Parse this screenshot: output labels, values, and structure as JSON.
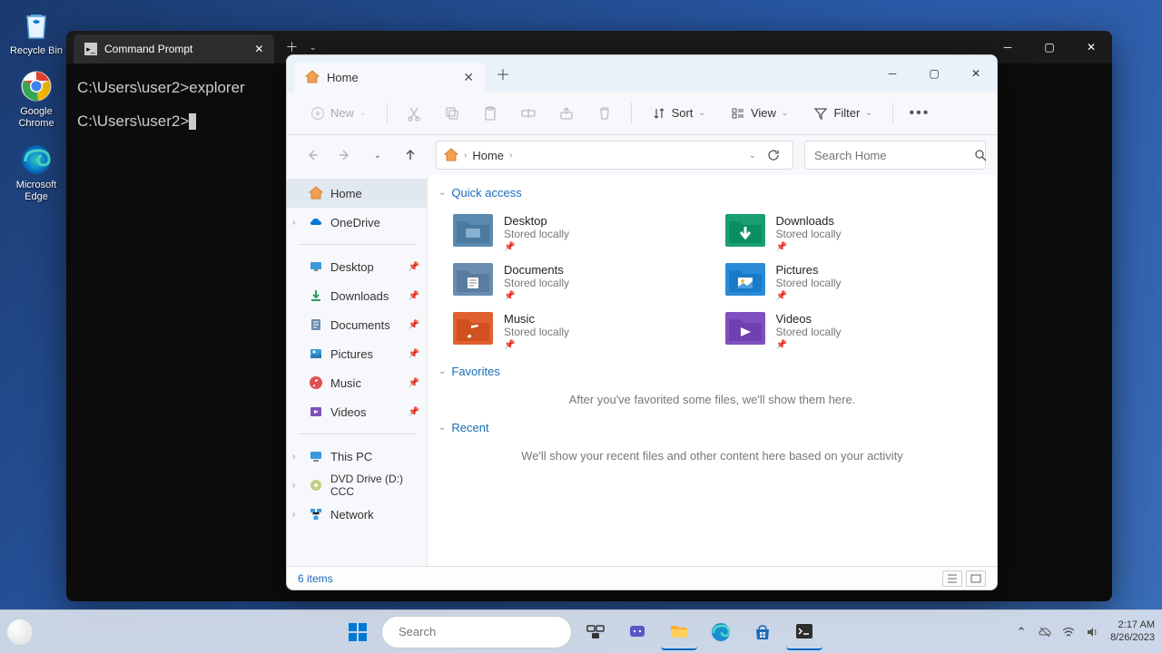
{
  "desktop_icons": {
    "recycle_bin": "Recycle Bin",
    "chrome": "Google Chrome",
    "edge": "Microsoft Edge"
  },
  "cmd": {
    "tab_title": "Command Prompt",
    "line1": "C:\\Users\\user2>explorer",
    "line2": "C:\\Users\\user2>"
  },
  "explorer": {
    "tab_title": "Home",
    "toolbar": {
      "new": "New",
      "sort": "Sort",
      "view": "View",
      "filter": "Filter"
    },
    "breadcrumb": "Home",
    "search_placeholder": "Search Home",
    "sidebar": {
      "home": "Home",
      "onedrive": "OneDrive",
      "desktop": "Desktop",
      "downloads": "Downloads",
      "documents": "Documents",
      "pictures": "Pictures",
      "music": "Music",
      "videos": "Videos",
      "this_pc": "This PC",
      "dvd": "DVD Drive (D:) CCC",
      "network": "Network"
    },
    "sections": {
      "quick_access": "Quick access",
      "favorites": "Favorites",
      "recent": "Recent"
    },
    "quick_access_items": {
      "desktop": {
        "name": "Desktop",
        "sub": "Stored locally"
      },
      "downloads": {
        "name": "Downloads",
        "sub": "Stored locally"
      },
      "documents": {
        "name": "Documents",
        "sub": "Stored locally"
      },
      "pictures": {
        "name": "Pictures",
        "sub": "Stored locally"
      },
      "music": {
        "name": "Music",
        "sub": "Stored locally"
      },
      "videos": {
        "name": "Videos",
        "sub": "Stored locally"
      }
    },
    "favorites_empty": "After you've favorited some files, we'll show them here.",
    "recent_empty": "We'll show your recent files and other content here based on your activity",
    "status": "6 items"
  },
  "taskbar": {
    "search_placeholder": "Search",
    "time": "2:17 AM",
    "date": "8/26/2023"
  }
}
